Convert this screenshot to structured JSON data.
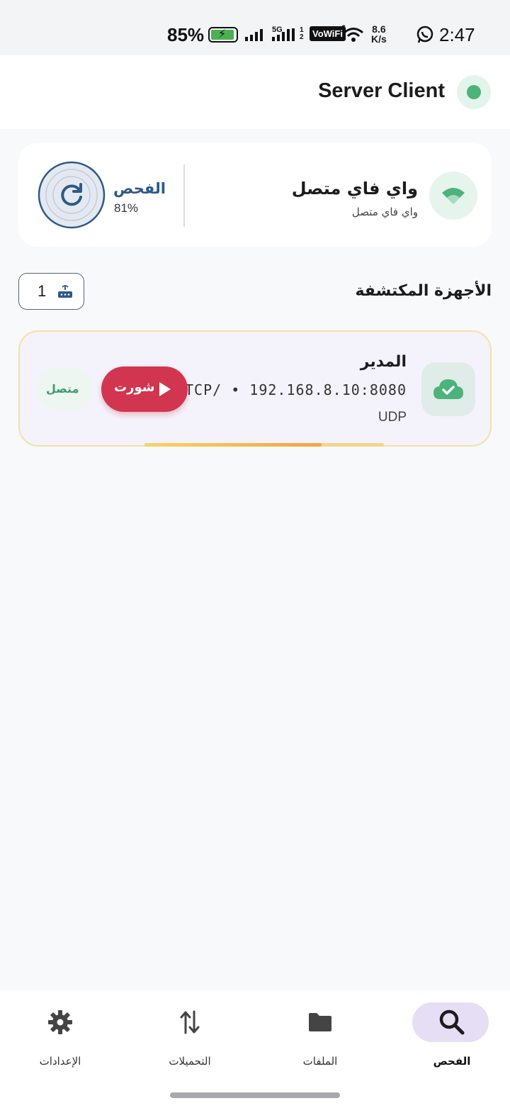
{
  "status_bar": {
    "battery_pct": "85%",
    "network_5g": "5G",
    "sim_numbers": "1 2",
    "vowifi": "VoWiFi",
    "wifi_level": "6",
    "speed_value": "8.6",
    "speed_unit": "K/s",
    "time": "2:47",
    "icons": [
      "battery-charging-icon",
      "signal-bars-icon",
      "vowifi-icon",
      "wifi-icon",
      "whatsapp-icon"
    ]
  },
  "app_bar": {
    "title": "Server Client",
    "status_color": "#4cb37a"
  },
  "network_card": {
    "wifi_title": "واي فاي متصل",
    "wifi_subtitle": "واي فاي متصل",
    "scan_title": "الفحص",
    "scan_percent": "81%",
    "scan_progress": 0.81,
    "icon": "wifi-icon"
  },
  "devices_section": {
    "title": "الأجهزة المكتشفة",
    "count": "1",
    "count_icon": "router-icon"
  },
  "devices": [
    {
      "name": "المدير",
      "address": "TCP/ • 192.168.8.10:8080",
      "protocol": "UDP",
      "action_label": "شورت",
      "status_label": "متصل",
      "icon": "cloud-check-icon",
      "progress": 0.74
    }
  ],
  "bottom_nav": {
    "items": [
      {
        "label": "الفحص",
        "icon": "search-icon",
        "active": true
      },
      {
        "label": "الملفات",
        "icon": "folder-icon",
        "active": false
      },
      {
        "label": "التحميلات",
        "icon": "transfer-arrows-icon",
        "active": false
      },
      {
        "label": "الإعدادات",
        "icon": "gear-icon",
        "active": false
      }
    ]
  },
  "colors": {
    "accent_red": "#d2354f",
    "accent_green": "#4cb37a",
    "scan_blue": "#2e5a87",
    "nav_active_bg": "#e6def5"
  }
}
